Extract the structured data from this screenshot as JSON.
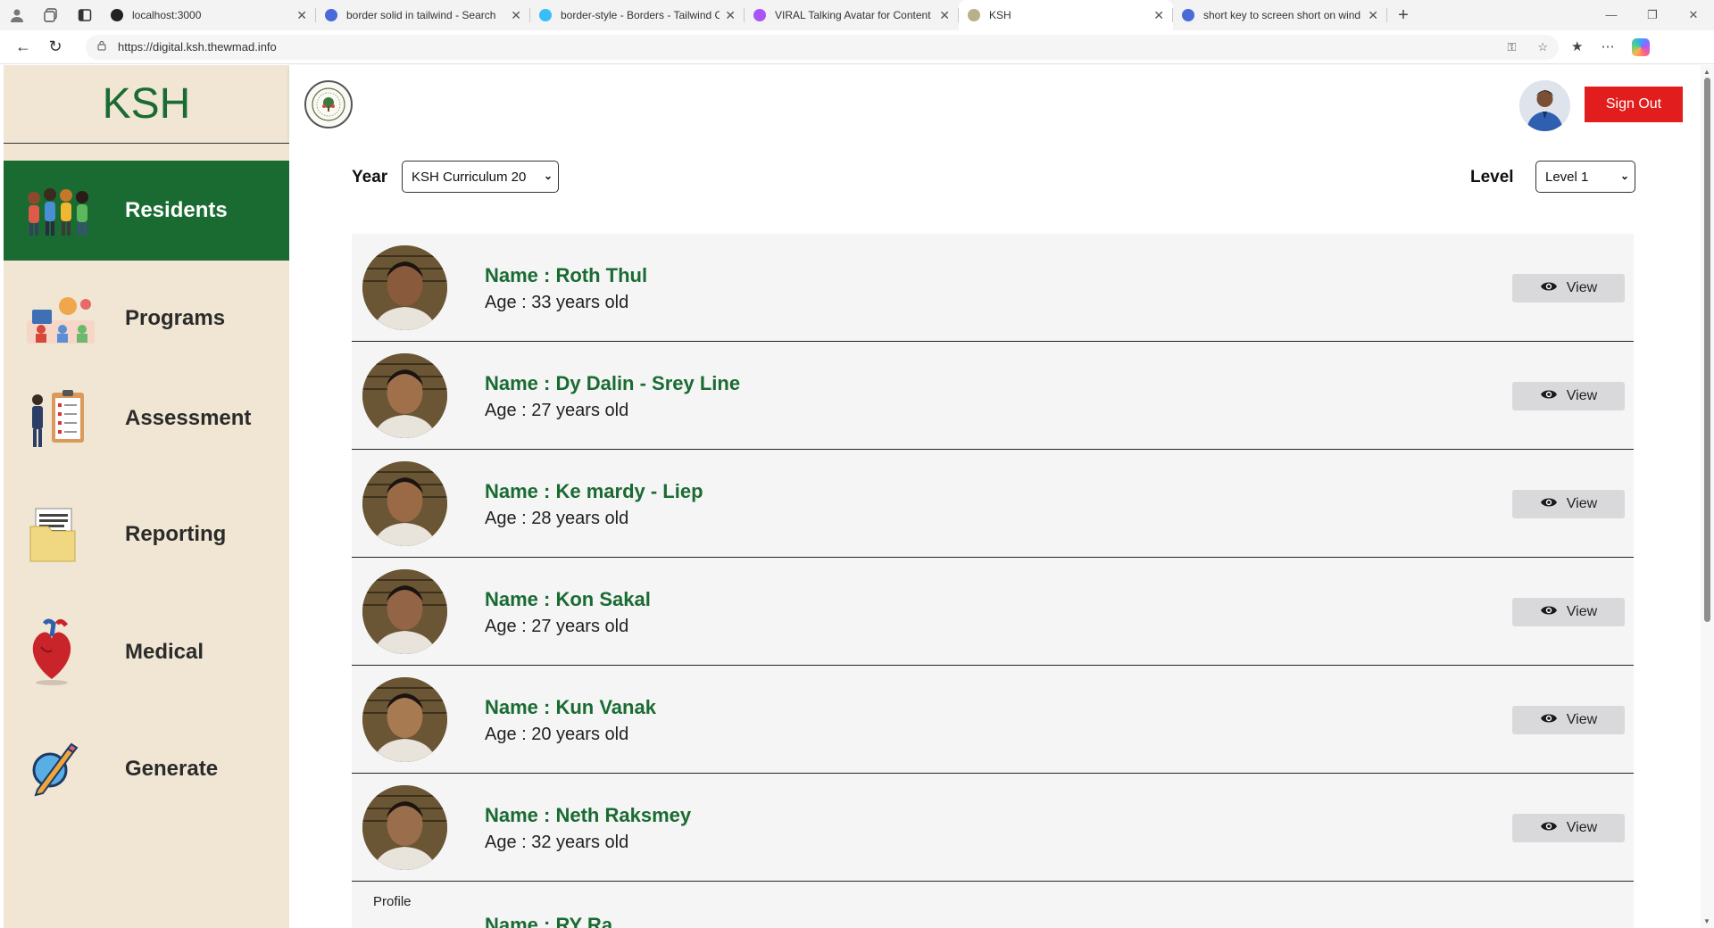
{
  "browser": {
    "tabs": [
      {
        "title": "localhost:3000",
        "color": "#222222"
      },
      {
        "title": "border solid in tailwind - Search",
        "color": "#4a6ad8"
      },
      {
        "title": "border-style - Borders - Tailwind C",
        "color": "#38bdf8"
      },
      {
        "title": "VIRAL Talking Avatar for Content C",
        "color": "#a855f7"
      },
      {
        "title": "KSH",
        "color": "#b9b08a"
      },
      {
        "title": "short key to screen short on wind",
        "color": "#4a6ad8"
      }
    ],
    "active_tab": 4,
    "url": "https://digital.ksh.thewmad.info"
  },
  "sidebar": {
    "brand": "KSH",
    "items": [
      {
        "label": "Residents",
        "icon": "residents-group-icon",
        "active": true
      },
      {
        "label": "Programs",
        "icon": "programs-icon",
        "active": false
      },
      {
        "label": "Assessment",
        "icon": "assessment-clipboard-icon",
        "active": false
      },
      {
        "label": "Reporting",
        "icon": "reporting-folder-icon",
        "active": false
      },
      {
        "label": "Medical",
        "icon": "medical-heart-icon",
        "active": false
      },
      {
        "label": "Generate",
        "icon": "generate-pencil-icon",
        "active": false
      }
    ]
  },
  "header": {
    "sign_out_label": "Sign Out"
  },
  "filters": {
    "year_label": "Year",
    "year_value": "KSH Curriculum 20",
    "level_label": "Level",
    "level_value": "Level 1"
  },
  "residents": [
    {
      "name": "Name : Roth Thul",
      "age": "Age : 33 years old",
      "view": "View",
      "skin": "#8a5a3c"
    },
    {
      "name": "Name : Dy Dalin - Srey Line",
      "age": "Age : 27 years old",
      "view": "View",
      "skin": "#a0704a"
    },
    {
      "name": "Name : Ke mardy - Liep",
      "age": "Age : 28 years old",
      "view": "View",
      "skin": "#9a6a46"
    },
    {
      "name": "Name : Kon Sakal",
      "age": "Age : 27 years old",
      "view": "View",
      "skin": "#946446"
    },
    {
      "name": "Name : Kun Vanak",
      "age": "Age : 20 years old",
      "view": "View",
      "skin": "#a87a52"
    },
    {
      "name": "Name : Neth Raksmey",
      "age": "Age : 32 years old",
      "view": "View",
      "skin": "#9a6e4c"
    }
  ],
  "partial_resident": {
    "alt_text": "Profile",
    "name": "Name : RY Ra"
  },
  "colors": {
    "brand_green": "#1a6b32",
    "sidebar_bg": "#f0e6d3",
    "sign_out_red": "#e11d1d"
  }
}
